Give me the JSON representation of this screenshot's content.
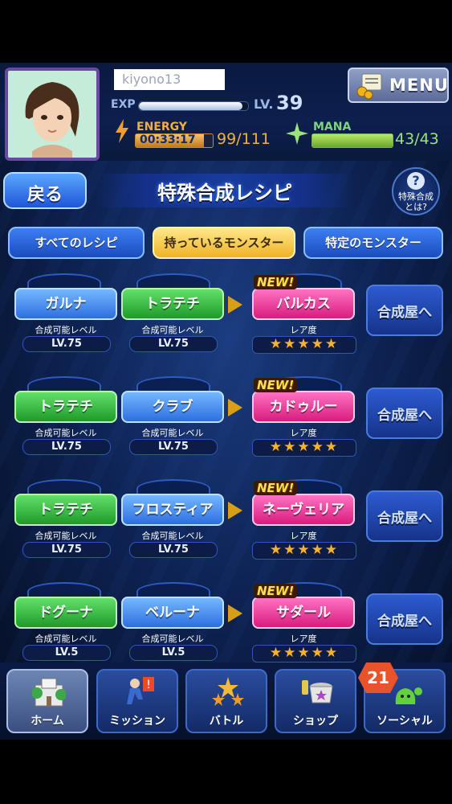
{
  "status": {
    "username": "kiyono13",
    "menu_label": "MENU",
    "exp_label": "EXP",
    "exp_progress": 0.95,
    "lv_label": "LV.",
    "level": "39",
    "energy_label": "ENERGY",
    "energy_timer": "00:33:17",
    "energy_value": "99/111",
    "energy_progress": 0.89,
    "mana_label": "MANA",
    "mana_value": "43/43",
    "mana_progress": 1.0
  },
  "header": {
    "back_label": "戻る",
    "title": "特殊合成レシピ",
    "help_line1": "特殊合成",
    "help_line2": "とは?"
  },
  "tabs": [
    {
      "label": "すべてのレシピ"
    },
    {
      "label": "持っているモンスター"
    },
    {
      "label": "特定のモンスター"
    }
  ],
  "recipes": [
    {
      "m1": "ガルナ",
      "m1_color": "blue",
      "m1_req": "合成可能レベル",
      "m1_lv": "LV.75",
      "m2": "トラテチ",
      "m2_color": "green",
      "m2_req": "合成可能レベル",
      "m2_lv": "LV.75",
      "new": "NEW!",
      "result": "バルカス",
      "rare_label": "レア度",
      "stars": "★★★★★",
      "craft": "合成屋へ"
    },
    {
      "m1": "トラテチ",
      "m1_color": "green",
      "m1_req": "合成可能レベル",
      "m1_lv": "LV.75",
      "m2": "クラブ",
      "m2_color": "blue",
      "m2_req": "合成可能レベル",
      "m2_lv": "LV.75",
      "new": "NEW!",
      "result": "カドゥルー",
      "rare_label": "レア度",
      "stars": "★★★★★",
      "craft": "合成屋へ"
    },
    {
      "m1": "トラテチ",
      "m1_color": "green",
      "m1_req": "合成可能レベル",
      "m1_lv": "LV.75",
      "m2": "フロスティア",
      "m2_color": "blue",
      "m2_req": "合成可能レベル",
      "m2_lv": "LV.75",
      "new": "NEW!",
      "result": "ネーヴェリア",
      "rare_label": "レア度",
      "stars": "★★★★★",
      "craft": "合成屋へ"
    },
    {
      "m1": "ドグーナ",
      "m1_color": "green",
      "m1_req": "合成可能レベル",
      "m1_lv": "LV.5",
      "m2": "ベルーナ",
      "m2_color": "blue",
      "m2_req": "合成可能レベル",
      "m2_lv": "LV.5",
      "new": "NEW!",
      "result": "サダール",
      "rare_label": "レア度",
      "stars": "★★★★★",
      "craft": "合成屋へ"
    }
  ],
  "nav": [
    {
      "label": "ホーム",
      "icon": "home-icon"
    },
    {
      "label": "ミッション",
      "icon": "mission-icon"
    },
    {
      "label": "バトル",
      "icon": "battle-stars-icon"
    },
    {
      "label": "ショップ",
      "icon": "shop-pot-icon"
    },
    {
      "label": "ソーシャル",
      "icon": "social-slime-icon"
    }
  ],
  "social_badge": "21",
  "colors": {
    "accent_blue": "#2d6ee0",
    "accent_green": "#1f9a2a",
    "accent_pink": "#d81c7e",
    "star": "#ffb228",
    "new": "#ffe04a"
  }
}
